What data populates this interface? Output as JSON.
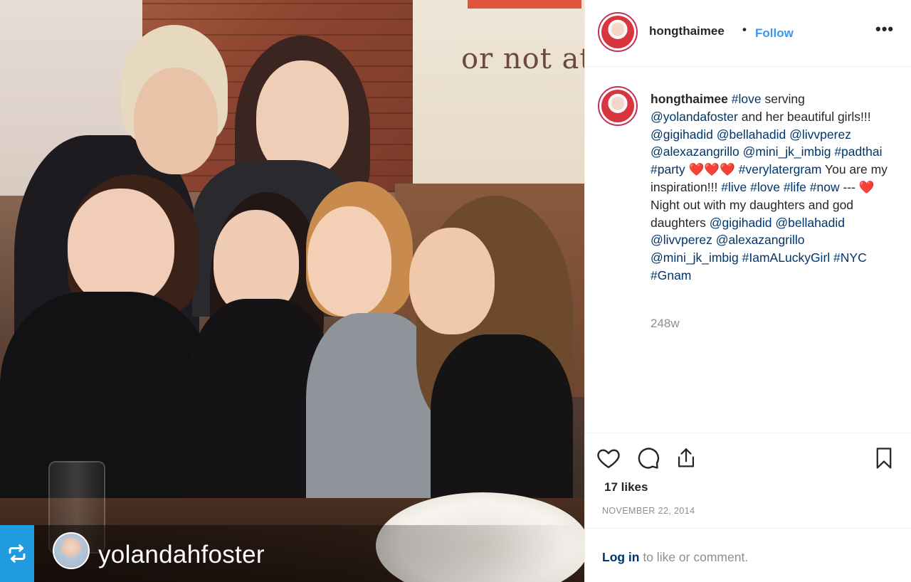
{
  "photo": {
    "poster_text": "or not at",
    "repost": {
      "icon": "repost-icon",
      "username": "yolandahfoster"
    }
  },
  "post": {
    "header": {
      "username": "hongthaimee",
      "dot": "•",
      "follow_label": "Follow",
      "more_icon": "more-options-icon",
      "more_label": "•••"
    },
    "caption": {
      "username": "hongthaimee",
      "segments": [
        {
          "t": "#love",
          "link": true
        },
        {
          "t": " serving ",
          "link": false
        },
        {
          "t": "@yolandafoster",
          "link": true
        },
        {
          "t": " and her beautiful girls!!! ",
          "link": false
        },
        {
          "t": "@gigihadid",
          "link": true
        },
        {
          "t": " ",
          "link": false
        },
        {
          "t": "@bellahadid",
          "link": true
        },
        {
          "t": " ",
          "link": false
        },
        {
          "t": "@livvperez",
          "link": true
        },
        {
          "t": " ",
          "link": false
        },
        {
          "t": "@alexazangrillo",
          "link": true
        },
        {
          "t": " ",
          "link": false
        },
        {
          "t": "@mini_jk_imbig",
          "link": true
        },
        {
          "t": " ",
          "link": false
        },
        {
          "t": "#padthai",
          "link": true
        },
        {
          "t": " ",
          "link": false
        },
        {
          "t": "#party",
          "link": true
        },
        {
          "t": " ",
          "link": false
        },
        {
          "t": "❤️❤️❤️",
          "heart": true
        },
        {
          "t": " ",
          "link": false
        },
        {
          "t": "#verylatergram",
          "link": true
        },
        {
          "t": " You are my inspiration!!! ",
          "link": false
        },
        {
          "t": "#live",
          "link": true
        },
        {
          "t": " ",
          "link": false
        },
        {
          "t": "#love",
          "link": true
        },
        {
          "t": " ",
          "link": false
        },
        {
          "t": "#life",
          "link": true
        },
        {
          "t": " ",
          "link": false
        },
        {
          "t": "#now",
          "link": true
        },
        {
          "t": " --- ",
          "link": false
        },
        {
          "t": "❤️",
          "heart": true
        },
        {
          "t": "Night out with my daughters and god daughters ",
          "link": false
        },
        {
          "t": "@gigihadid",
          "link": true
        },
        {
          "t": " ",
          "link": false
        },
        {
          "t": "@bellahadid",
          "link": true
        },
        {
          "t": " ",
          "link": false
        },
        {
          "t": "@livvperez",
          "link": true
        },
        {
          "t": " ",
          "link": false
        },
        {
          "t": "@alexazangrillo",
          "link": true
        },
        {
          "t": " ",
          "link": false
        },
        {
          "t": "@mini_jk_imbig",
          "link": true
        },
        {
          "t": " ",
          "link": false
        },
        {
          "t": "#IamALuckyGirl",
          "link": true
        },
        {
          "t": " ",
          "link": false
        },
        {
          "t": "#NYC",
          "link": true
        },
        {
          "t": " ",
          "link": false
        },
        {
          "t": "#Gnam",
          "link": true
        }
      ],
      "age": "248w"
    },
    "actions": {
      "like_icon": "heart-icon",
      "comment_icon": "comment-icon",
      "share_icon": "share-icon",
      "save_icon": "bookmark-icon"
    },
    "likes": "17 likes",
    "date": "NOVEMBER 22, 2014",
    "login": {
      "link": "Log in",
      "rest": " to like or comment."
    }
  }
}
